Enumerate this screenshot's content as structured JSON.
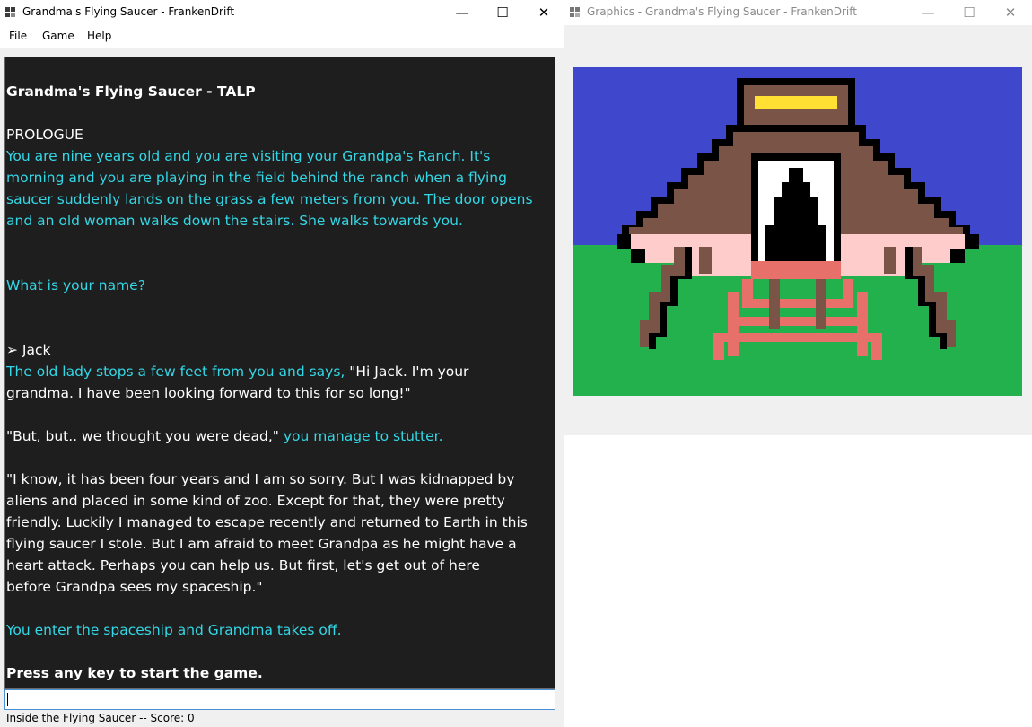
{
  "main_window": {
    "title": "Grandma's Flying Saucer - FrankenDrift",
    "caption": {
      "minimize": "—",
      "maximize": "☐",
      "close": "✕"
    },
    "menu": [
      "File",
      "Game",
      "Help"
    ]
  },
  "transcript": {
    "game_title": "Grandma's Flying Saucer - TALP",
    "prologue_heading": "PROLOGUE",
    "intro": [
      "You are nine years old and you are visiting your Grandpa's Ranch. It's",
      "morning and you are playing in the field behind the ranch when a flying",
      "saucer suddenly lands on the grass a few meters from you. The door opens",
      "and an old woman walks down the stairs. She walks towards you."
    ],
    "question": "What is your name?",
    "player_input": "➢ Jack",
    "lady_line1_cyan": "The old lady stops a few feet from you and says, ",
    "lady_line1_white": "\"Hi Jack. I'm your",
    "lady_line2": "grandma. I have been looking forward to this for so long!\"",
    "but_white": "\"But, but.. we thought you were dead,\" ",
    "but_cyan": "you manage to stutter.",
    "grandma_speech": [
      "\"I know, it has been four years and I am so sorry. But I was kidnapped by",
      "aliens and placed in some kind of zoo. Except for that, they were pretty",
      "friendly. Luckily I managed to escape recently and returned to Earth in this",
      "flying saucer I stole. But I am afraid to meet Grandpa as he might have a",
      "heart attack. Perhaps you can help us. But first, let's get out of here",
      "before Grandpa sees my spaceship.\""
    ],
    "enter_line": "You enter the spaceship and Grandma takes off.",
    "press_key": "Press any key to start the game."
  },
  "input": {
    "value": ""
  },
  "status": {
    "text": "Inside the Flying Saucer -- Score: 0"
  },
  "graphics_window": {
    "title": "Graphics - Grandma's Flying Saucer - FrankenDrift",
    "caption": {
      "minimize": "—",
      "maximize": "☐",
      "close": "✕"
    },
    "colors": {
      "sky": "#3f48cc",
      "grass": "#22b14c",
      "saucer_body": "#7a5547",
      "outline": "#000000",
      "window_white": "#ffffff",
      "pink": "#ffcccc",
      "stairs": "#e8706a",
      "yellow_light": "#ffe033"
    }
  },
  "colors": {
    "transcript_bg": "#1e1e1e",
    "cyan_text": "#33d7e6",
    "white_text": "#ffffff"
  }
}
